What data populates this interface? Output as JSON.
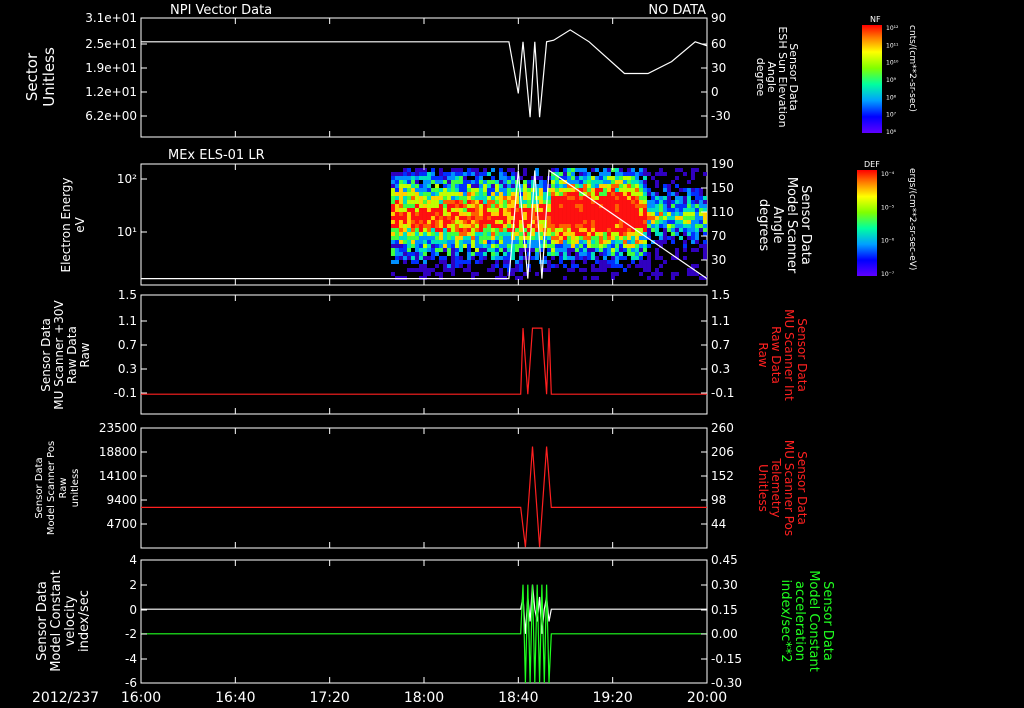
{
  "colors": {
    "background": "#000000",
    "axes": "#ffffff",
    "red": "#ff2020",
    "green": "#20ff20"
  },
  "panel1": {
    "title": "NPI Vector Data",
    "status": "NO DATA",
    "left_label": [
      "Sector",
      "Unitless"
    ],
    "right_label": [
      "Sensor Data",
      "ESH Sun Elevation",
      "Angle",
      "degree"
    ]
  },
  "panel2": {
    "title": "MEx ELS-01 LR",
    "left_label": [
      "Electron Energy",
      "eV"
    ],
    "right_label": [
      "Sensor Data",
      "Model Scanner",
      "Angle",
      "degrees"
    ]
  },
  "panel3": {
    "left_label": [
      "Sensor Data",
      "MU Scanner +30V",
      "Raw Data",
      "Raw"
    ],
    "right_label": [
      "Sensor Data",
      "MU Scanner Int",
      "Raw Data",
      "Raw"
    ]
  },
  "panel4": {
    "left_label": [
      "Sensor Data",
      "Model Scanner Pos",
      "Raw",
      "unitless"
    ],
    "right_label": [
      "Sensor Data",
      "MU Scanner Pos",
      "Telemetry",
      "Unitless"
    ]
  },
  "panel5": {
    "left_label": [
      "Sensor Data",
      "Model Constant",
      "velocity",
      "index/sec"
    ],
    "right_label": [
      "Sensor Data",
      "Model Constant",
      "acceleration",
      "index/sec**2"
    ]
  },
  "colorbar1": {
    "tag": "NF",
    "label": "cnts/(cm**2-sr-sec)",
    "ticks": [
      "10¹²",
      "10¹¹",
      "10¹⁰",
      "10⁹",
      "10⁸",
      "10⁷",
      "10⁶"
    ]
  },
  "colorbar2": {
    "tag": "DEF",
    "label": "ergs/(cm**2-sr-sec-eV)",
    "ticks": [
      "10⁻⁴",
      "10⁻⁵",
      "10⁻⁶",
      "10⁻⁷"
    ]
  },
  "date_label": "2012/237",
  "chart_data": [
    {
      "type": "line",
      "x": [
        "16:00",
        "18:36",
        "18:40",
        "18:42",
        "18:45",
        "18:47",
        "18:49",
        "18:52",
        "18:55",
        "19:02",
        "19:10",
        "19:25",
        "19:35",
        "19:45",
        "19:55",
        "20:00"
      ],
      "series": [
        {
          "name": "Sector",
          "values": []
        },
        {
          "name": "ESH Sun Elevation Angle",
          "values": [
            60,
            60,
            -5,
            60,
            -35,
            60,
            -35,
            60,
            62,
            75,
            60,
            20,
            20,
            35,
            60,
            55
          ]
        }
      ],
      "title": "NPI Vector Data",
      "status": "NO DATA",
      "left_ticks": [
        "3.1e+01",
        "2.5e+01",
        "1.9e+01",
        "1.2e+01",
        "6.2e+00"
      ],
      "right_ticks": [
        "90",
        "60",
        "30",
        "0",
        "-30"
      ],
      "right_ylim": [
        -60,
        90
      ]
    },
    {
      "type": "heatmap",
      "title": "MEx ELS-01 LR",
      "xlim": [
        "16:00",
        "20:00"
      ],
      "data_start": "17:46",
      "ylabel": "Electron Energy eV",
      "yscale": "log",
      "left_ticks": [
        "10²",
        "10¹"
      ],
      "right_ticks": [
        "190",
        "150",
        "110",
        "70",
        "30"
      ],
      "right_ylim": [
        0,
        190
      ],
      "scanner_angle": {
        "x": [
          "16:00",
          "18:36",
          "18:40",
          "18:44",
          "18:47",
          "18:50",
          "18:53",
          "20:00"
        ],
        "values": [
          10,
          10,
          180,
          10,
          180,
          10,
          180,
          10
        ]
      }
    },
    {
      "type": "line",
      "x": [
        "16:00",
        "18:41",
        "18:42",
        "18:44",
        "18:46",
        "18:50",
        "18:52",
        "18:53",
        "18:54",
        "20:00"
      ],
      "series": [
        {
          "name": "MU Scanner Int Raw Data",
          "values": [
            0,
            0,
            1,
            0,
            1,
            1,
            0,
            1,
            0,
            0
          ]
        }
      ],
      "left_ticks": [
        "1.5",
        "1.1",
        "0.7",
        "0.3",
        "-0.1"
      ],
      "right_ticks": [
        "1.5",
        "1.1",
        "0.7",
        "0.3",
        "-0.1"
      ],
      "ylim": [
        -0.3,
        1.5
      ]
    },
    {
      "type": "line",
      "x": [
        "16:00",
        "18:41",
        "18:43",
        "18:46",
        "18:49",
        "18:52",
        "18:54",
        "20:00"
      ],
      "series": [
        {
          "name": "MU Scanner Pos Telemetry",
          "values": [
            88,
            88,
            2,
            220,
            2,
            220,
            88,
            88
          ]
        }
      ],
      "left_ticks": [
        "23500",
        "18800",
        "14100",
        "9400",
        "4700"
      ],
      "right_ticks": [
        "260",
        "206",
        "152",
        "98",
        "44"
      ],
      "right_ylim": [
        0,
        260
      ]
    },
    {
      "type": "line",
      "x": [
        "16:00",
        "18:41",
        "18:42",
        "18:43",
        "18:44",
        "18:45",
        "18:46",
        "18:47",
        "18:48",
        "18:49",
        "18:50",
        "18:51",
        "18:52",
        "18:53",
        "18:54",
        "20:00"
      ],
      "series": [
        {
          "name": "Model Constant velocity",
          "values": [
            0,
            0,
            1,
            -2,
            1,
            -1,
            2,
            0,
            -1,
            1,
            -2,
            0,
            1,
            -1,
            0,
            0
          ]
        },
        {
          "name": "Model Constant acceleration",
          "values": [
            0,
            0,
            0.3,
            -0.3,
            0.3,
            -0.3,
            0.3,
            -0.3,
            0.3,
            -0.3,
            0.3,
            -0.3,
            0.3,
            -0.3,
            0,
            0
          ]
        }
      ],
      "left_ticks": [
        "4",
        "2",
        "0",
        "-2",
        "-4",
        "-6"
      ],
      "right_ticks": [
        "0.45",
        "0.30",
        "0.15",
        "0.00",
        "-0.15",
        "-0.30"
      ],
      "left_ylim": [
        -6,
        4
      ],
      "right_ylim": [
        -0.3,
        0.45
      ]
    }
  ],
  "x_axis": {
    "ticks": [
      "16:00",
      "16:40",
      "17:20",
      "18:00",
      "18:40",
      "19:20",
      "20:00"
    ]
  }
}
